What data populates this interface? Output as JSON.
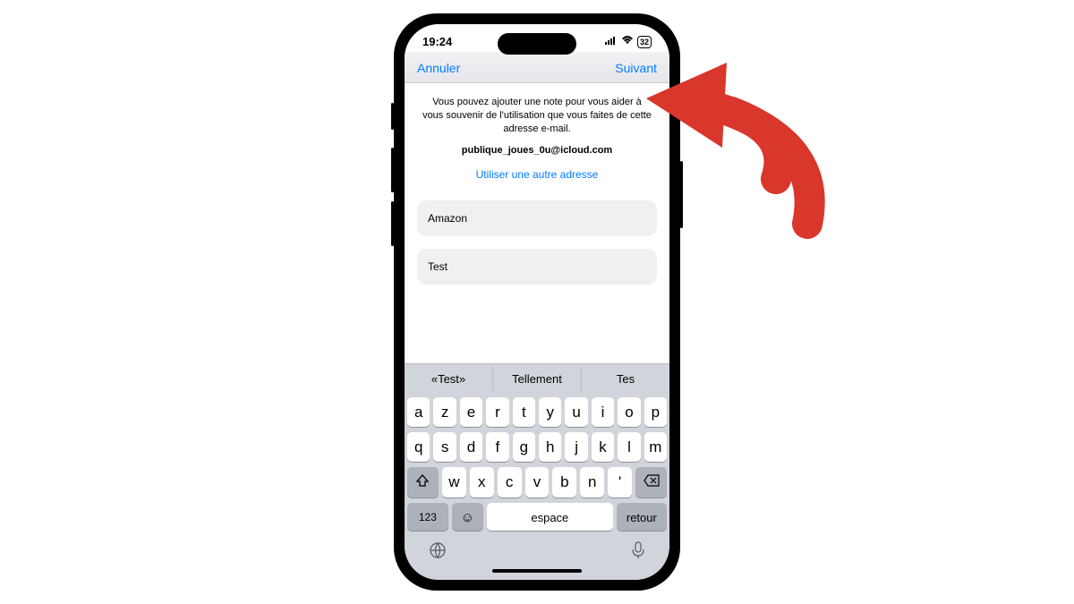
{
  "status": {
    "time": "19:24",
    "battery": "32"
  },
  "nav": {
    "cancel": "Annuler",
    "next": "Suivant"
  },
  "content": {
    "helper": "Vous pouvez ajouter une note pour vous aider à vous souvenir de l'utilisation que vous faites de cette adresse e-mail.",
    "email": "publique_joues_0u@icloud.com",
    "other_link": "Utiliser une autre adresse",
    "input1": "Amazon",
    "input2": "Test"
  },
  "suggestions": [
    "«Test»",
    "Tellement",
    "Tes"
  ],
  "keyboard": {
    "row1": [
      "a",
      "z",
      "e",
      "r",
      "t",
      "y",
      "u",
      "i",
      "o",
      "p"
    ],
    "row2": [
      "q",
      "s",
      "d",
      "f",
      "g",
      "h",
      "j",
      "k",
      "l",
      "m"
    ],
    "row3": [
      "w",
      "x",
      "c",
      "v",
      "b",
      "n",
      "'"
    ],
    "n123": "123",
    "space": "espace",
    "return": "retour"
  },
  "colors": {
    "blue": "#007aff",
    "red_arrow": "#d9362c"
  }
}
